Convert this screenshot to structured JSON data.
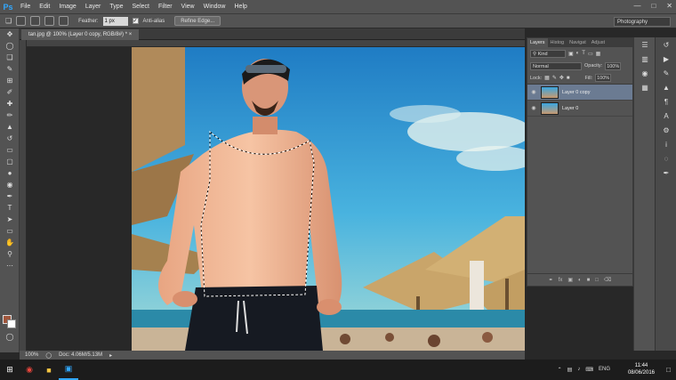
{
  "app": {
    "logo": "Ps"
  },
  "menu": [
    "File",
    "Edit",
    "Image",
    "Layer",
    "Type",
    "Select",
    "Filter",
    "View",
    "Window",
    "Help"
  ],
  "options": {
    "feather_label": "Feather:",
    "feather_value": "1 px",
    "antialias_label": "Anti-alias",
    "refine_edge": "Refine Edge...",
    "workspace": "Photography"
  },
  "document": {
    "tab_title": "tan.jpg @ 100% (Layer 0 copy, RGB/8#) *",
    "zoom": "100%",
    "doc_info": "Doc: 4.06M/5.13M"
  },
  "layers_panel": {
    "tabs": [
      "Layers",
      "Histog",
      "Navigat",
      "Adjust"
    ],
    "kind": "Kind",
    "blend": "Normal",
    "opacity_label": "Opacity:",
    "opacity": "100%",
    "lock_label": "Lock:",
    "fill_label": "Fill:",
    "fill": "100%",
    "layers": [
      {
        "name": "Layer 0 copy",
        "selected": true
      },
      {
        "name": "Layer 0",
        "selected": false
      }
    ],
    "footer_icons": [
      "link-icon",
      "fx-icon",
      "mask-icon",
      "adjustment-icon",
      "folder-icon",
      "new-layer-icon",
      "trash-icon"
    ]
  },
  "taskbar": {
    "time": "11:44",
    "date": "08/06/2016",
    "lang": "ENG"
  },
  "colors": {
    "foreground": "#a0563c",
    "background": "#ffffff",
    "selected_layer": "#6b7b92"
  }
}
